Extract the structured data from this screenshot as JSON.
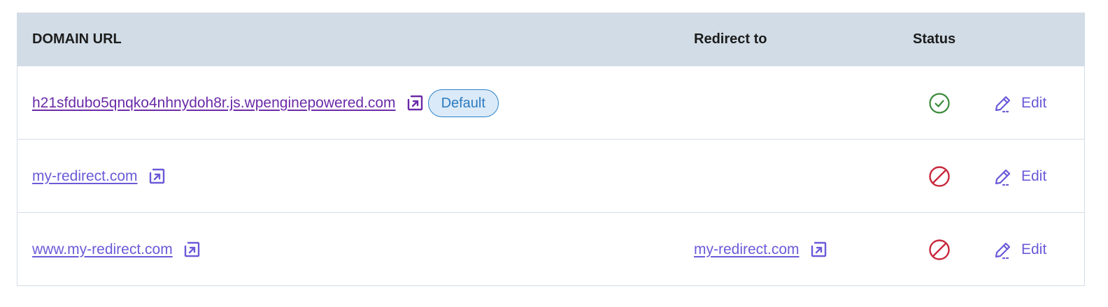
{
  "table": {
    "headers": {
      "domain": "DOMAIN URL",
      "redirect": "Redirect to",
      "status": "Status"
    },
    "rows": [
      {
        "domain": "h21sfdubo5qnqko4nhnydoh8r.js.wpenginepowered.com",
        "badge": "Default",
        "redirect": "",
        "status": "active",
        "edit_label": "Edit"
      },
      {
        "domain": "my-redirect.com",
        "badge": "",
        "redirect": "",
        "status": "blocked",
        "edit_label": "Edit"
      },
      {
        "domain": "www.my-redirect.com",
        "badge": "",
        "redirect": "my-redirect.com",
        "status": "blocked",
        "edit_label": "Edit"
      }
    ]
  },
  "colors": {
    "header_bg": "#d1dce6",
    "link_visited": "#6b2aa8",
    "link": "#6a5ad8",
    "status_ok": "#3a8a3a",
    "status_blocked": "#c8283c",
    "badge_border": "#2c83c9",
    "badge_bg": "#dbeaf8"
  },
  "icons": {
    "external": "external-link-icon",
    "status_active": "check-circle-icon",
    "status_blocked": "blocked-icon",
    "edit": "pencil-icon"
  }
}
